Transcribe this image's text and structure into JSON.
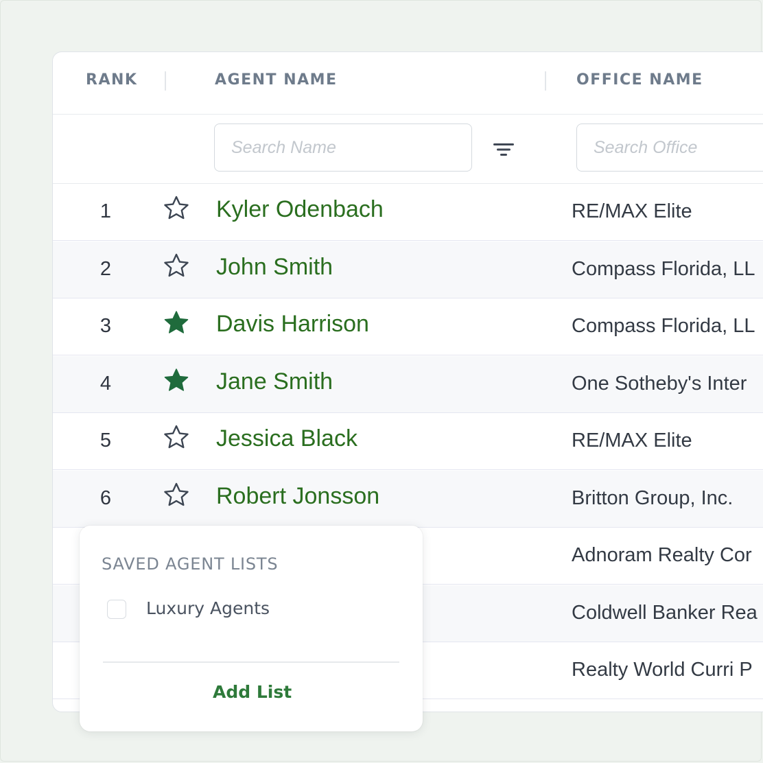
{
  "columns": {
    "rank": "RANK",
    "agent_name": "AGENT NAME",
    "office_name": "OFFICE NAME"
  },
  "filters": {
    "name_placeholder": "Search Name",
    "office_placeholder": "Search Office",
    "name_value": "",
    "office_value": ""
  },
  "colors": {
    "accent_green": "#2a6e1f",
    "star_filled": "#1f6b3c"
  },
  "rows": [
    {
      "rank": "1",
      "starred": false,
      "agent": "Kyler Odenbach",
      "office": "RE/MAX Elite"
    },
    {
      "rank": "2",
      "starred": false,
      "agent": "John Smith",
      "office": "Compass Florida, LL"
    },
    {
      "rank": "3",
      "starred": true,
      "agent": "Davis Harrison",
      "office": "Compass Florida, LL"
    },
    {
      "rank": "4",
      "starred": true,
      "agent": "Jane Smith",
      "office": "One Sotheby's Inter"
    },
    {
      "rank": "5",
      "starred": false,
      "agent": "Jessica Black",
      "office": "RE/MAX Elite"
    },
    {
      "rank": "6",
      "starred": false,
      "agent": "Robert Jonsson",
      "office": "Britton Group, Inc."
    },
    {
      "rank": "",
      "starred": false,
      "agent": "",
      "office": "Adnoram Realty Cor"
    },
    {
      "rank": "",
      "starred": false,
      "agent": "",
      "office": "Coldwell Banker Rea"
    },
    {
      "rank": "",
      "starred": false,
      "agent": "",
      "office": "Realty World Curri P"
    }
  ],
  "popover": {
    "title": "SAVED AGENT LISTS",
    "lists": [
      {
        "label": "Luxury Agents",
        "checked": false
      }
    ],
    "add_label": "Add List"
  }
}
